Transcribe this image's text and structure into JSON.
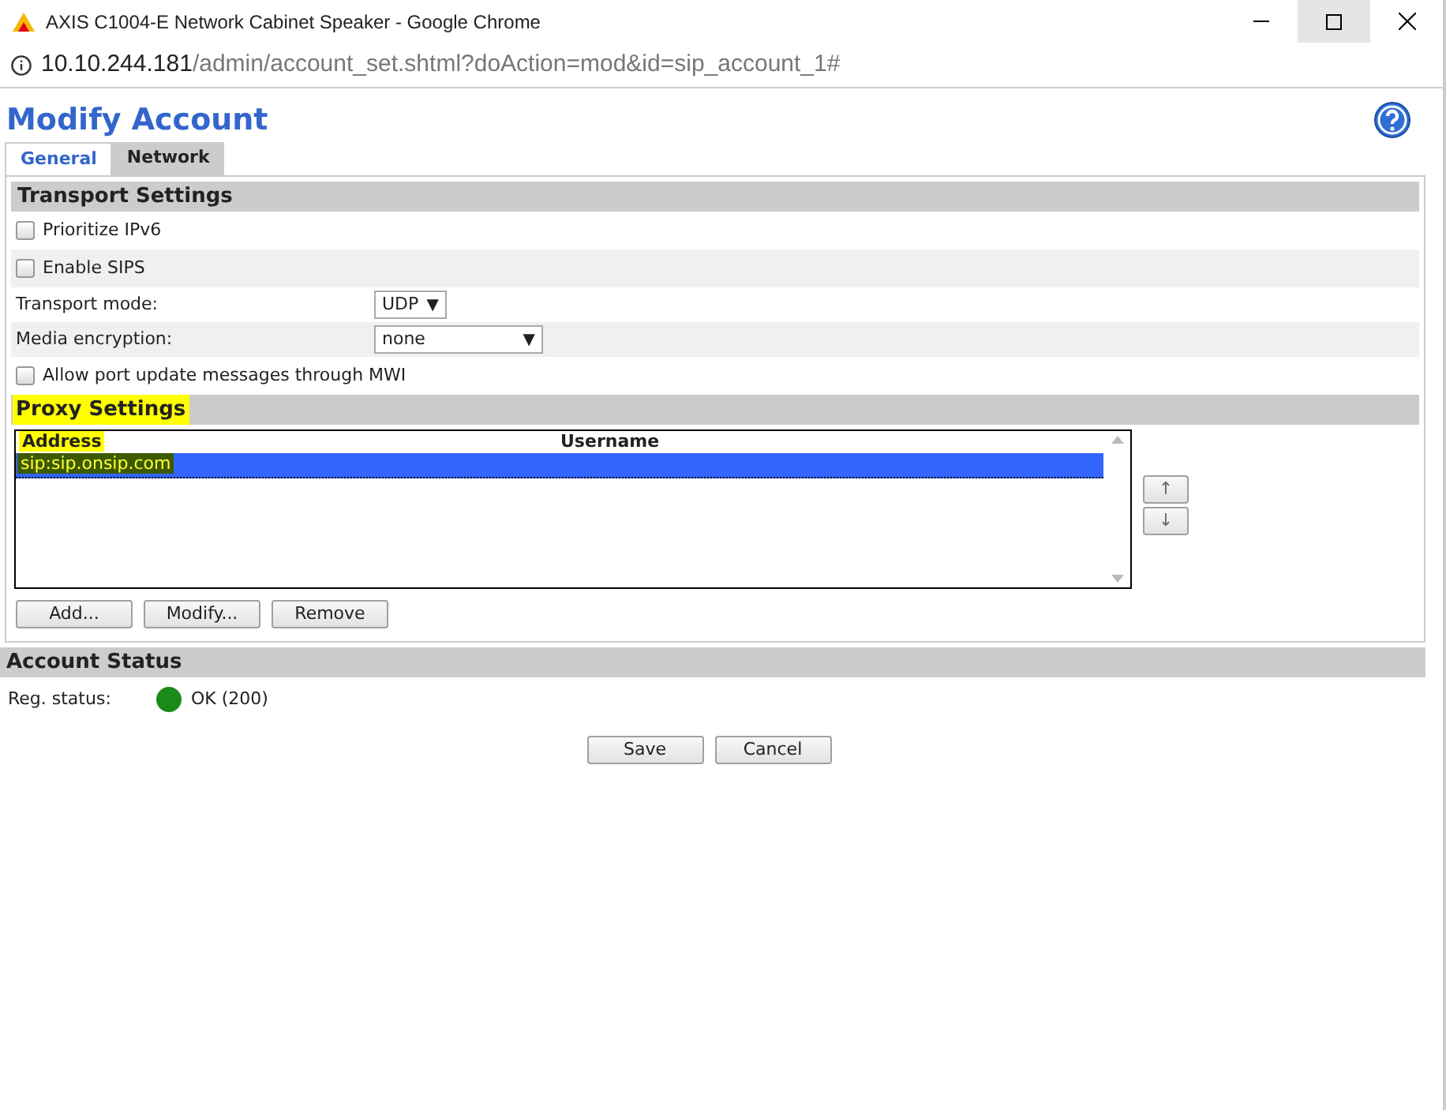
{
  "window": {
    "title": "AXIS C1004-E Network Cabinet Speaker - Google Chrome"
  },
  "address_bar": {
    "host": "10.10.244.181",
    "path": "/admin/account_set.shtml?doAction=mod&id=sip_account_1#"
  },
  "page_title": "Modify Account",
  "tabs": [
    {
      "label": "General",
      "selected": true
    },
    {
      "label": "Network",
      "selected": false
    }
  ],
  "transport_settings": {
    "heading": "Transport Settings",
    "rows": [
      {
        "kind": "checkbox",
        "label": "Prioritize IPv6",
        "checked": false
      },
      {
        "kind": "checkbox",
        "label": "Enable SIPS",
        "checked": false
      },
      {
        "kind": "select",
        "label": "Transport mode:",
        "value": "UDP",
        "arrow": "▼",
        "wide": false
      },
      {
        "kind": "select",
        "label": "Media encryption:",
        "value": "none",
        "arrow": "▼",
        "wide": true
      },
      {
        "kind": "checkbox",
        "label": "Allow port update messages through MWI",
        "checked": false
      }
    ]
  },
  "proxy_settings": {
    "heading": "Proxy Settings",
    "highlighted": true,
    "columns": [
      "Address",
      "Username"
    ],
    "rows": [
      {
        "address": "sip:sip.onsip.com",
        "username": "",
        "selected": true,
        "highlighted": true
      }
    ],
    "move_buttons": [
      "↑",
      "↓"
    ],
    "buttons": [
      "Add...",
      "Modify...",
      "Remove"
    ]
  },
  "account_status": {
    "heading": "Account Status",
    "label": "Reg. status:",
    "value": "OK (200)",
    "color": "#1a8a1a"
  },
  "buttons": [
    "Save",
    "Cancel"
  ]
}
